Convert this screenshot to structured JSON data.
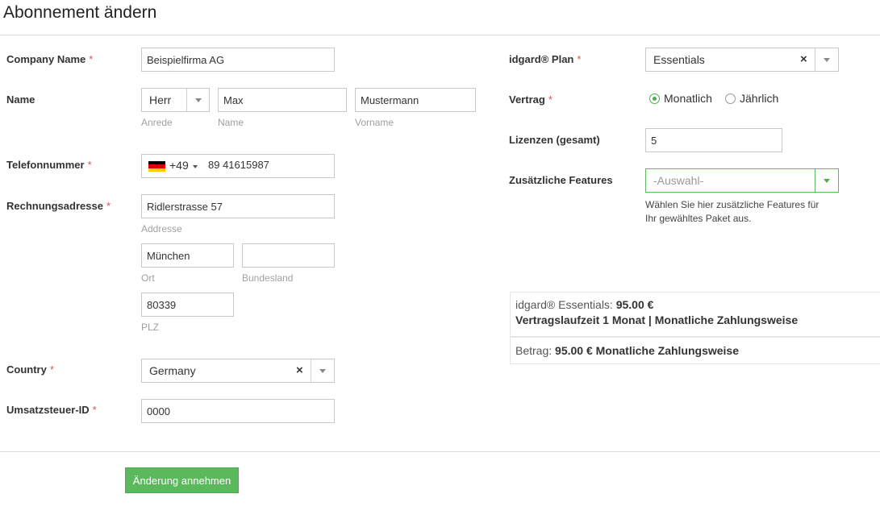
{
  "page": {
    "title": "Abonnement ändern"
  },
  "left": {
    "company": {
      "label": "Company Name",
      "required": "*",
      "value": "Beispielfirma AG"
    },
    "name": {
      "label": "Name",
      "salutation": {
        "value": "Herr",
        "caption": "Anrede"
      },
      "first": {
        "value": "Max",
        "caption": "Name"
      },
      "last": {
        "value": "Mustermann",
        "caption": "Vorname"
      }
    },
    "phone": {
      "label": "Telefonnummer",
      "required": "*",
      "dial_code": "+49",
      "number": "89 41615987",
      "flag_colors": [
        "#000000",
        "#dd0000",
        "#ffce00"
      ]
    },
    "address": {
      "label": "Rechnungsadresse",
      "required": "*",
      "street": {
        "value": "Ridlerstrasse 57",
        "caption": "Addresse"
      },
      "city": {
        "value": "München",
        "caption": "Ort"
      },
      "state": {
        "value": "",
        "caption": "Bundesland"
      },
      "zip": {
        "value": "80339",
        "caption": "PLZ"
      }
    },
    "country": {
      "label": "Country",
      "required": "*",
      "value": "Germany",
      "clear": "×"
    },
    "vat": {
      "label": "Umsatzsteuer-ID",
      "required": "*",
      "value": "0000"
    }
  },
  "right": {
    "plan": {
      "label": "idgard® Plan",
      "required": "*",
      "value": "Essentials",
      "clear": "×"
    },
    "contract": {
      "label": "Vertrag",
      "required": "*",
      "options": [
        {
          "label": "Monatlich",
          "selected": true
        },
        {
          "label": "Jährlich",
          "selected": false
        }
      ]
    },
    "licenses": {
      "label": "Lizenzen (gesamt)",
      "value": "5"
    },
    "features": {
      "label": "Zusätzliche Features",
      "placeholder": "-Auswahl-",
      "help_line1": "Wählen Sie hier zusätzliche Features für",
      "help_line2": "Ihr gewähltes Paket aus."
    },
    "summary": {
      "plan_prefix": "idgard® Essentials:",
      "plan_price": "95.00 €",
      "term": "Vertragslaufzeit 1 Monat | Monatliche Zahlungsweise",
      "amount_prefix": "Betrag:",
      "amount": "95.00 € Monatliche Zahlungsweise"
    }
  },
  "submit": {
    "label": "Änderung annehmen"
  },
  "colors": {
    "accent": "#5cb85c",
    "required": "#d9534f",
    "focus": "#4cae4c"
  }
}
